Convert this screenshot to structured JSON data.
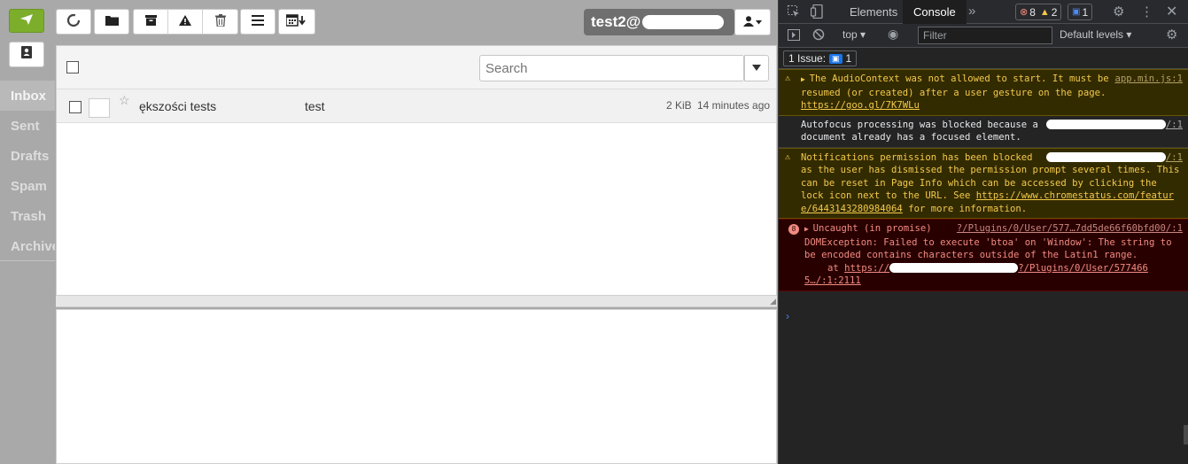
{
  "app": {
    "folders": [
      "Inbox",
      "Sent",
      "Drafts",
      "Spam",
      "Trash",
      "Archive"
    ],
    "account_name": "test2@",
    "search_placeholder": "Search",
    "messages": [
      {
        "subject": "ększości tests",
        "from": "test",
        "size": "2 KiB",
        "date": "14 minutes ago"
      }
    ]
  },
  "devtools": {
    "tabs": [
      "Elements",
      "Console"
    ],
    "active_tab": "Console",
    "error_count": "8",
    "warning_count": "2",
    "message_count": "1",
    "context": "top",
    "filter_placeholder": "Filter",
    "levels": "Default levels",
    "issues_label": "1 Issue:",
    "issues_count": "1",
    "logs": [
      {
        "level": "warning",
        "text": "The AudioContext was not allowed to start. It must be resumed (or created) after a user gesture on the page.",
        "link": "https://goo.gl/7K7WLu",
        "source": "app.min.js:1"
      },
      {
        "level": "info",
        "text_a": "Autofocus processing was blocked",
        "text_b": "because a document already has a focused element.",
        "source": "/:1"
      },
      {
        "level": "warning",
        "text_a": "Notifications permission has been",
        "text_b": "blocked as the user has dismissed the permission prompt several times. This can be reset in Page Info which can be accessed by clicking the lock icon next to the URL. See",
        "link": "https://www.chromestatus.com/feature/6443143280984064",
        "tail": "for more information.",
        "source": "/:1"
      },
      {
        "level": "error",
        "count": "8",
        "text_a": "Uncaught (in",
        "text_b": "promise) DOMException: Failed to execute 'btoa' on 'Window': The string to be encoded contains characters outside of the Latin1 range.",
        "at": "at",
        "at_link_a": "https://",
        "at_link_b": "?/Plugins/0/User/577466",
        "at_link_c": "5…/:1:2111",
        "source": "?/Plugins/0/User/577…7dd5de66f60bfd00/:1"
      }
    ],
    "colors": {
      "warning": "#f2c94c",
      "error": "#f28b82",
      "accent": "#3c87f7"
    }
  }
}
